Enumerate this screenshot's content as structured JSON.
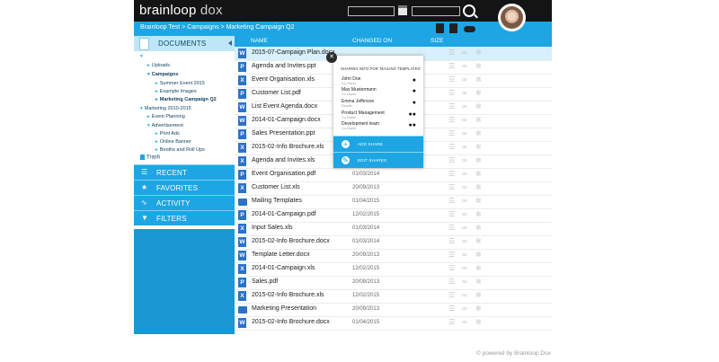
{
  "header": {
    "logo_main": "brainloop",
    "logo_sub": "dox",
    "calendar_icon": "calendar-icon",
    "search_icon": "search-icon"
  },
  "breadcrumb": {
    "text": "Brainloop Test > Campaigns > Marketing Campaign Q2"
  },
  "toolbar_icons": [
    "trash-icon",
    "library-icon",
    "cloud-icon"
  ],
  "sidebar": {
    "documents_label": "DOCUMENTS",
    "tree": [
      {
        "label": "",
        "depth": 0,
        "state": "open"
      },
      {
        "label": "Uploads",
        "depth": 1,
        "state": "closed"
      },
      {
        "label": "Campaigns",
        "depth": 1,
        "state": "open",
        "bold": true
      },
      {
        "label": "Summer Event 2015",
        "depth": 2,
        "state": "closed"
      },
      {
        "label": "Example Images",
        "depth": 2,
        "state": "closed"
      },
      {
        "label": "Marketing Campaign Q2",
        "depth": 2,
        "state": "closed",
        "bold": true
      },
      {
        "label": "Marketing 2010-2015",
        "depth": 0,
        "state": "open"
      },
      {
        "label": "Event Planning",
        "depth": 1,
        "state": "closed"
      },
      {
        "label": "Advertisement",
        "depth": 1,
        "state": "open"
      },
      {
        "label": "Print Ads",
        "depth": 2,
        "state": "closed"
      },
      {
        "label": "Online Banner",
        "depth": 2,
        "state": "closed"
      },
      {
        "label": "Booths and Roll Ups",
        "depth": 2,
        "state": "closed"
      }
    ],
    "trash_label": "Trash",
    "panels": [
      {
        "label": "RECENT",
        "icon": "stack-icon"
      },
      {
        "label": "FAVORITES",
        "icon": "star-icon"
      },
      {
        "label": "ACTIVITY",
        "icon": "pulse-icon"
      },
      {
        "label": "FILTERS",
        "icon": "funnel-icon"
      }
    ]
  },
  "table": {
    "columns": [
      "NAME",
      "CHANGED ON",
      "SIZE"
    ],
    "rows": [
      {
        "name": "2015-07-Campaign Plan.docx",
        "date": "",
        "type": "W",
        "selected": true
      },
      {
        "name": "Agenda and Invites.ppt",
        "date": "",
        "type": "P"
      },
      {
        "name": "Event Organisation.xls",
        "date": "",
        "type": "X"
      },
      {
        "name": "Customer List.pdf",
        "date": "",
        "type": "P"
      },
      {
        "name": "List Event Agenda.docx",
        "date": "",
        "type": "W"
      },
      {
        "name": "2014-01-Campaign.docx",
        "date": "",
        "type": "W"
      },
      {
        "name": "Sales Presentation.ppt",
        "date": "",
        "type": "P"
      },
      {
        "name": "2015-02-Info Brochure.xls",
        "date": "",
        "type": "X"
      },
      {
        "name": "Agenda and Invites.xls",
        "date": "",
        "type": "X"
      },
      {
        "name": "Event Organisation.pdf",
        "date": "01/03/2014",
        "type": "P"
      },
      {
        "name": "Customer List.xls",
        "date": "20/09/2013",
        "type": "X"
      },
      {
        "name": "Mailing Templates",
        "date": "01/04/2015",
        "type": "F"
      },
      {
        "name": "2014-01-Campaign.pdf",
        "date": "12/02/2015",
        "type": "P"
      },
      {
        "name": "Input Sales.xls",
        "date": "01/03/2014",
        "type": "X"
      },
      {
        "name": "2015-02-Info Brochure.docx",
        "date": "01/03/2014",
        "type": "W"
      },
      {
        "name": "Template Letter.docx",
        "date": "20/09/2013",
        "type": "W"
      },
      {
        "name": "2014-01-Campaign.xls",
        "date": "12/02/2015",
        "type": "X"
      },
      {
        "name": "Sales.pdf",
        "date": "20/09/2013",
        "type": "P"
      },
      {
        "name": "2015-02-Info Brochure.xls",
        "date": "12/02/2015",
        "type": "X"
      },
      {
        "name": "Marketing Presentation",
        "date": "20/09/2013",
        "type": "F"
      },
      {
        "name": "2015-02-Info Brochure.docx",
        "date": "01/04/2015",
        "type": "W"
      }
    ]
  },
  "sharing_popup": {
    "title": "SHARING INFO FOR 'MAILING TEMPLATES'",
    "people": [
      {
        "name": "John Doe",
        "role": "Co-Owner",
        "icon": "user-icon"
      },
      {
        "name": "Max Mustermann",
        "role": "Co-Owner",
        "icon": "user-icon"
      },
      {
        "name": "Emma Jefferson",
        "role": "Reader",
        "icon": "user-icon"
      },
      {
        "name": "Product Management",
        "role": "Co-Owner",
        "icon": "group-icon"
      },
      {
        "name": "Development team",
        "role": "Co-Owner",
        "icon": "group-icon"
      }
    ],
    "add_label": "ADD SHARE",
    "edit_label": "EDIT SHARES"
  },
  "footer": {
    "text": "© powered by Brainloop Dox"
  }
}
